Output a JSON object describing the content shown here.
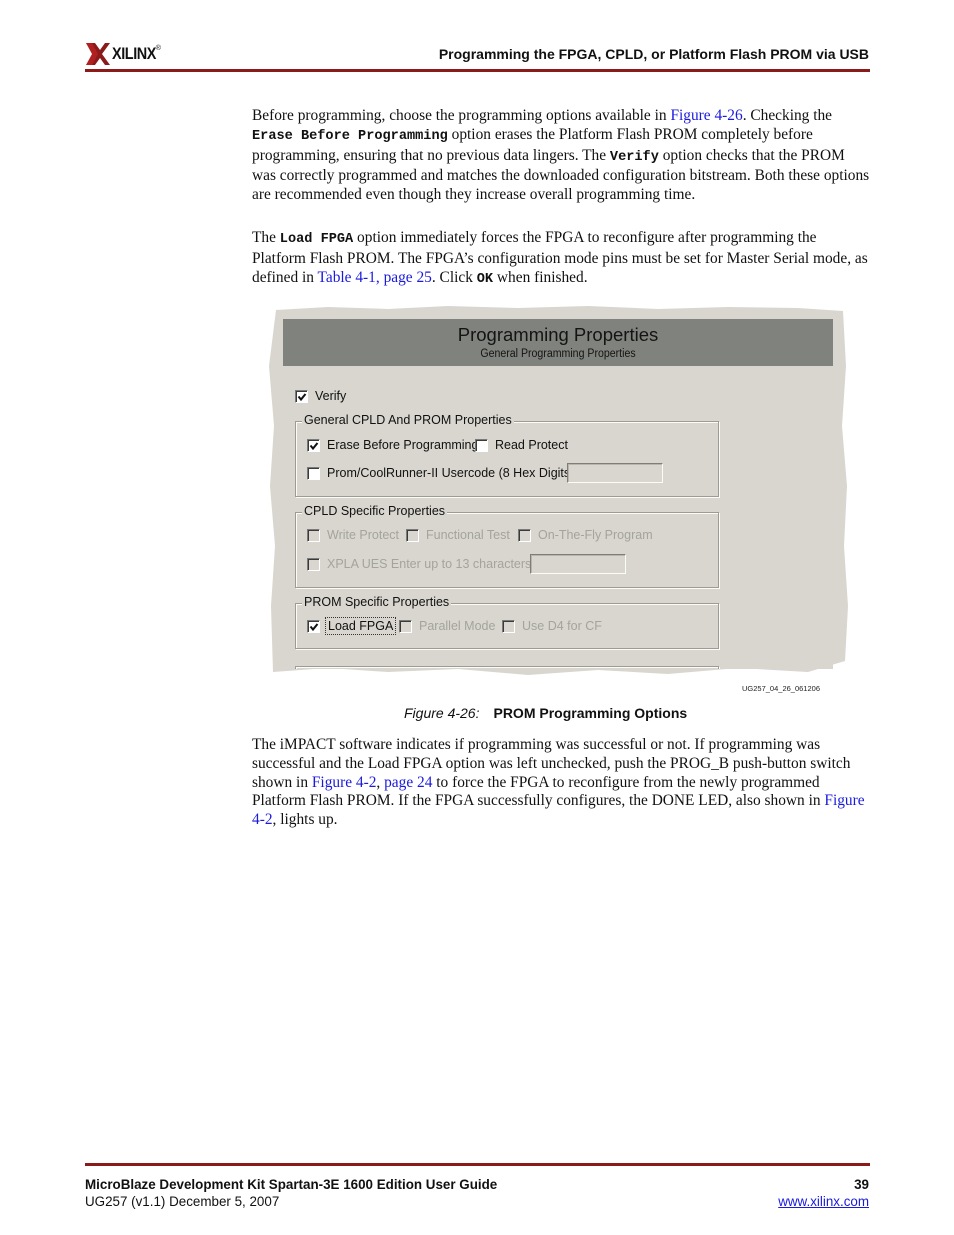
{
  "header": {
    "logo_text": "XILINX",
    "logo_reg": "®",
    "section_title": "Programming the FPGA, CPLD, or Platform Flash PROM via USB"
  },
  "colors": {
    "rule": "#8b1a1a",
    "link": "#1a1adc",
    "dialog_header": "#80827d",
    "dialog_body": "#d8d6ce"
  },
  "paragraphs": {
    "p1": {
      "s1": "Before programming, choose the programming options available in ",
      "link1": "Figure 4-26",
      "s2": ". Checking the ",
      "code1": "Erase Before Programming",
      "s3": " option erases the Platform Flash PROM completely before programming, ensuring that no previous data lingers. The ",
      "code2": "Verify",
      "s4": " option checks that the PROM was correctly programmed and matches the downloaded configuration bitstream. Both these options are recommended even though they increase overall programming time."
    },
    "p2": {
      "s1": "The ",
      "code1": "Load FPGA",
      "s2": " option immediately forces the FPGA to reconfigure after programming the Platform Flash PROM. The FPGA’s configuration mode pins must be set for Master Serial mode, as defined in ",
      "link1": "Table 4-1, page 25",
      "s3": ". Click ",
      "code2": "OK",
      "s4": " when finished."
    },
    "p3": {
      "s1": "The iMPACT software indicates if programming was successful or not. If programming was successful and the Load FPGA option was left unchecked, push the PROG_B push-button switch shown in ",
      "link1": "Figure 4-2",
      "s2": ", ",
      "link2": "page 24",
      "s3": " to force the FPGA to reconfigure from the newly programmed Platform Flash PROM. If the FPGA successfully configures, the DONE LED, also shown in ",
      "link3": "Figure 4-2",
      "s4": ", lights up."
    }
  },
  "dialog": {
    "title": "Programming Properties",
    "subtitle": "General Programming Properties",
    "verify": {
      "label": "Verify",
      "checked": true,
      "enabled": true
    },
    "groups": [
      {
        "legend": "General CPLD And PROM Properties",
        "options": [
          {
            "label": "Erase Before Programming",
            "checked": true,
            "enabled": true
          },
          {
            "label": "Read Protect",
            "checked": false,
            "enabled": true
          },
          {
            "label": "Prom/CoolRunner-II Usercode (8 Hex Digits)",
            "checked": false,
            "enabled": true,
            "input_value": ""
          }
        ]
      },
      {
        "legend": "CPLD Specific Properties",
        "options": [
          {
            "label": "Write Protect",
            "checked": false,
            "enabled": false
          },
          {
            "label": "Functional Test",
            "checked": false,
            "enabled": false
          },
          {
            "label": "On-The-Fly Program",
            "checked": false,
            "enabled": false
          },
          {
            "label": "XPLA UES Enter up to 13 characters",
            "checked": false,
            "enabled": false,
            "input_value": ""
          }
        ]
      },
      {
        "legend": "PROM Specific Properties",
        "options": [
          {
            "label": "Load FPGA",
            "checked": true,
            "enabled": true,
            "focused": true
          },
          {
            "label": "Parallel Mode",
            "checked": false,
            "enabled": false
          },
          {
            "label": "Use D4 for CF",
            "checked": false,
            "enabled": false
          }
        ]
      }
    ]
  },
  "figure": {
    "id": "UG257_04_26_061206",
    "number": "Figure 4-26:",
    "title": "PROM Programming Options"
  },
  "footer": {
    "doc_title": "MicroBlaze Development Kit Spartan-3E 1600 Edition User Guide",
    "doc_id": "UG257  (v1.1) December 5, 2007",
    "page_number": "39",
    "website": "www.xilinx.com"
  }
}
